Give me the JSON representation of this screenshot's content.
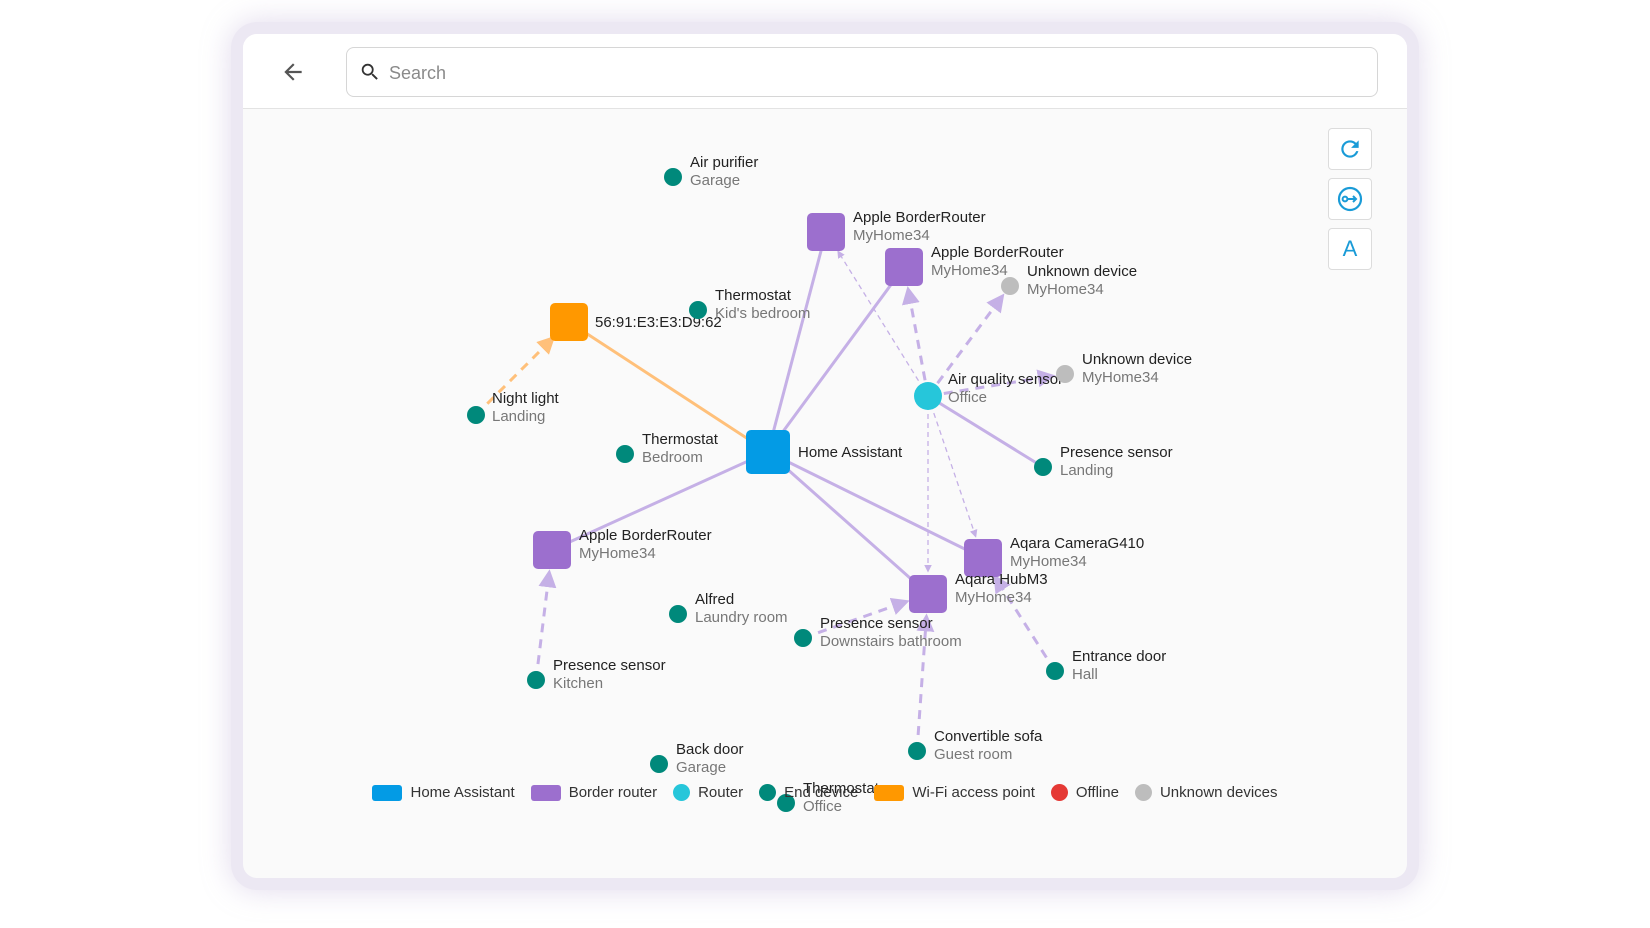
{
  "header": {
    "search_placeholder": "Search"
  },
  "toolbar": {
    "refresh_icon": "refresh-icon",
    "layout_icon": "layout-icon",
    "labels_button_text": "A"
  },
  "colors": {
    "home_assistant": "#039be5",
    "border_router": "#9c6fce",
    "router": "#26c6da",
    "end_device": "#00897b",
    "wifi_access_point": "#ff9800",
    "offline": "#e53935",
    "unknown": "#bdbdbd",
    "edge_router": "#c5b0e6",
    "edge_wifi": "#ffc07a"
  },
  "legend": [
    {
      "label": "Home Assistant",
      "shape": "rect",
      "color": "#039be5"
    },
    {
      "label": "Border router",
      "shape": "rect",
      "color": "#9c6fce"
    },
    {
      "label": "Router",
      "shape": "dot",
      "color": "#26c6da"
    },
    {
      "label": "End device",
      "shape": "dot",
      "color": "#00897b"
    },
    {
      "label": "Wi-Fi access point",
      "shape": "rect",
      "color": "#ff9800"
    },
    {
      "label": "Offline",
      "shape": "dot",
      "color": "#e53935"
    },
    {
      "label": "Unknown devices",
      "shape": "dot",
      "color": "#bdbdbd"
    }
  ],
  "nodes": [
    {
      "id": "ha",
      "type": "home_assistant",
      "name": "Home Assistant",
      "sub": ""
    },
    {
      "id": "br1",
      "type": "border_router",
      "name": "Apple BorderRouter",
      "sub": "MyHome34"
    },
    {
      "id": "br2",
      "type": "border_router",
      "name": "Apple BorderRouter",
      "sub": "MyHome34"
    },
    {
      "id": "br3",
      "type": "border_router",
      "name": "Apple BorderRouter",
      "sub": "MyHome34"
    },
    {
      "id": "aqcam",
      "type": "border_router",
      "name": "Aqara CameraG410",
      "sub": "MyHome34"
    },
    {
      "id": "aqhub",
      "type": "border_router",
      "name": "Aqara HubM3",
      "sub": "MyHome34"
    },
    {
      "id": "wifi",
      "type": "wifi_access_point",
      "name": "56:91:E3:E3:D9:62",
      "sub": ""
    },
    {
      "id": "air",
      "type": "router",
      "name": "Air quality sensor",
      "sub": "Office"
    },
    {
      "id": "airpur",
      "type": "end_device",
      "name": "Air purifier",
      "sub": "Garage"
    },
    {
      "id": "thermkid",
      "type": "end_device",
      "name": "Thermostat",
      "sub": "Kid's bedroom"
    },
    {
      "id": "unk1",
      "type": "unknown",
      "name": "Unknown device",
      "sub": "MyHome34"
    },
    {
      "id": "unk2",
      "type": "unknown",
      "name": "Unknown device",
      "sub": "MyHome34"
    },
    {
      "id": "night",
      "type": "end_device",
      "name": "Night light",
      "sub": "Landing"
    },
    {
      "id": "thermbed",
      "type": "end_device",
      "name": "Thermostat",
      "sub": "Bedroom"
    },
    {
      "id": "presland",
      "type": "end_device",
      "name": "Presence sensor",
      "sub": "Landing"
    },
    {
      "id": "alfred",
      "type": "end_device",
      "name": "Alfred",
      "sub": "Laundry room"
    },
    {
      "id": "presdown",
      "type": "end_device",
      "name": "Presence sensor",
      "sub": "Downstairs bathroom"
    },
    {
      "id": "entrance",
      "type": "end_device",
      "name": "Entrance door",
      "sub": "Hall"
    },
    {
      "id": "preskit",
      "type": "end_device",
      "name": "Presence sensor",
      "sub": "Kitchen"
    },
    {
      "id": "sofa",
      "type": "end_device",
      "name": "Convertible sofa",
      "sub": "Guest room"
    },
    {
      "id": "backdoor",
      "type": "end_device",
      "name": "Back door",
      "sub": "Garage"
    },
    {
      "id": "thermoff",
      "type": "end_device",
      "name": "Thermostat",
      "sub": "Office"
    }
  ],
  "edges": [
    {
      "from": "ha",
      "to": "br1",
      "style": "solid",
      "kind": "router"
    },
    {
      "from": "ha",
      "to": "br2",
      "style": "solid",
      "kind": "router"
    },
    {
      "from": "ha",
      "to": "br3",
      "style": "solid",
      "kind": "router"
    },
    {
      "from": "ha",
      "to": "aqcam",
      "style": "solid",
      "kind": "router"
    },
    {
      "from": "ha",
      "to": "aqhub",
      "style": "solid",
      "kind": "router"
    },
    {
      "from": "ha",
      "to": "wifi",
      "style": "solid",
      "kind": "wifi"
    },
    {
      "from": "night",
      "to": "wifi",
      "style": "dashed",
      "kind": "wifi"
    },
    {
      "from": "air",
      "to": "br2",
      "style": "dashed",
      "kind": "router"
    },
    {
      "from": "air",
      "to": "unk1",
      "style": "dashed",
      "kind": "router"
    },
    {
      "from": "air",
      "to": "unk2",
      "style": "dashed",
      "kind": "router"
    },
    {
      "from": "air",
      "to": "presland",
      "style": "solid",
      "kind": "router"
    },
    {
      "from": "air",
      "to": "br1",
      "style": "thin",
      "kind": "router"
    },
    {
      "from": "air",
      "to": "aqcam",
      "style": "thin",
      "kind": "router"
    },
    {
      "from": "air",
      "to": "aqhub",
      "style": "thin",
      "kind": "router"
    },
    {
      "from": "preskit",
      "to": "br3",
      "style": "dashed",
      "kind": "router"
    },
    {
      "from": "presdown",
      "to": "aqhub",
      "style": "dashed",
      "kind": "router"
    },
    {
      "from": "sofa",
      "to": "aqhub",
      "style": "dashed",
      "kind": "router"
    },
    {
      "from": "entrance",
      "to": "aqcam",
      "style": "dashed",
      "kind": "router"
    }
  ]
}
